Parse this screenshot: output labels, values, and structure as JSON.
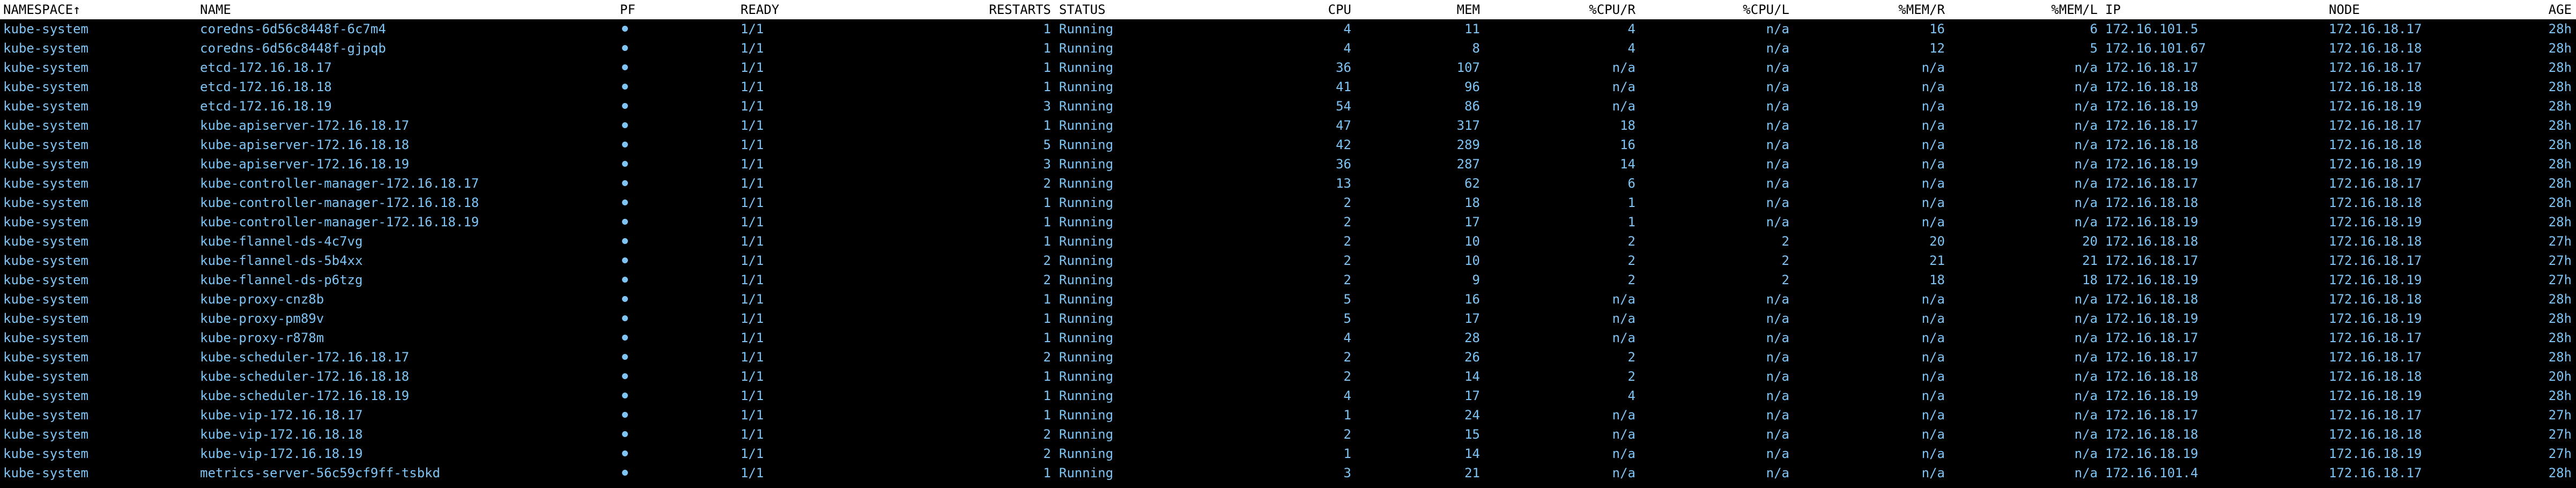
{
  "theme": {
    "foreground": "#7ec4f5",
    "header_bg": "#ffffff",
    "background": "#000000"
  },
  "header": {
    "namespace": "NAMESPACE↑",
    "name": "NAME",
    "pf": "PF",
    "ready": "READY",
    "restarts": "RESTARTS",
    "status": "STATUS",
    "cpu": "CPU",
    "mem": "MEM",
    "cpu_r": "%CPU/R",
    "cpu_l": "%CPU/L",
    "mem_r": "%MEM/R",
    "mem_l": "%MEM/L",
    "ip": "IP",
    "node": "NODE",
    "age": "AGE"
  },
  "pf_icon": "port-forward-dot-icon",
  "rows": [
    {
      "namespace": "kube-system",
      "name": "coredns-6d56c8448f-6c7m4",
      "ready": "1/1",
      "restarts": "1",
      "status": "Running",
      "cpu": "4",
      "mem": "11",
      "cpu_r": "4",
      "cpu_l": "n/a",
      "mem_r": "16",
      "mem_l": "6",
      "ip": "172.16.101.5",
      "node": "172.16.18.17",
      "age": "28h"
    },
    {
      "namespace": "kube-system",
      "name": "coredns-6d56c8448f-gjpqb",
      "ready": "1/1",
      "restarts": "1",
      "status": "Running",
      "cpu": "4",
      "mem": "8",
      "cpu_r": "4",
      "cpu_l": "n/a",
      "mem_r": "12",
      "mem_l": "5",
      "ip": "172.16.101.67",
      "node": "172.16.18.18",
      "age": "28h"
    },
    {
      "namespace": "kube-system",
      "name": "etcd-172.16.18.17",
      "ready": "1/1",
      "restarts": "1",
      "status": "Running",
      "cpu": "36",
      "mem": "107",
      "cpu_r": "n/a",
      "cpu_l": "n/a",
      "mem_r": "n/a",
      "mem_l": "n/a",
      "ip": "172.16.18.17",
      "node": "172.16.18.17",
      "age": "28h"
    },
    {
      "namespace": "kube-system",
      "name": "etcd-172.16.18.18",
      "ready": "1/1",
      "restarts": "1",
      "status": "Running",
      "cpu": "41",
      "mem": "96",
      "cpu_r": "n/a",
      "cpu_l": "n/a",
      "mem_r": "n/a",
      "mem_l": "n/a",
      "ip": "172.16.18.18",
      "node": "172.16.18.18",
      "age": "28h"
    },
    {
      "namespace": "kube-system",
      "name": "etcd-172.16.18.19",
      "ready": "1/1",
      "restarts": "3",
      "status": "Running",
      "cpu": "54",
      "mem": "86",
      "cpu_r": "n/a",
      "cpu_l": "n/a",
      "mem_r": "n/a",
      "mem_l": "n/a",
      "ip": "172.16.18.19",
      "node": "172.16.18.19",
      "age": "28h"
    },
    {
      "namespace": "kube-system",
      "name": "kube-apiserver-172.16.18.17",
      "ready": "1/1",
      "restarts": "1",
      "status": "Running",
      "cpu": "47",
      "mem": "317",
      "cpu_r": "18",
      "cpu_l": "n/a",
      "mem_r": "n/a",
      "mem_l": "n/a",
      "ip": "172.16.18.17",
      "node": "172.16.18.17",
      "age": "28h"
    },
    {
      "namespace": "kube-system",
      "name": "kube-apiserver-172.16.18.18",
      "ready": "1/1",
      "restarts": "5",
      "status": "Running",
      "cpu": "42",
      "mem": "289",
      "cpu_r": "16",
      "cpu_l": "n/a",
      "mem_r": "n/a",
      "mem_l": "n/a",
      "ip": "172.16.18.18",
      "node": "172.16.18.18",
      "age": "28h"
    },
    {
      "namespace": "kube-system",
      "name": "kube-apiserver-172.16.18.19",
      "ready": "1/1",
      "restarts": "3",
      "status": "Running",
      "cpu": "36",
      "mem": "287",
      "cpu_r": "14",
      "cpu_l": "n/a",
      "mem_r": "n/a",
      "mem_l": "n/a",
      "ip": "172.16.18.19",
      "node": "172.16.18.19",
      "age": "28h"
    },
    {
      "namespace": "kube-system",
      "name": "kube-controller-manager-172.16.18.17",
      "ready": "1/1",
      "restarts": "2",
      "status": "Running",
      "cpu": "13",
      "mem": "62",
      "cpu_r": "6",
      "cpu_l": "n/a",
      "mem_r": "n/a",
      "mem_l": "n/a",
      "ip": "172.16.18.17",
      "node": "172.16.18.17",
      "age": "28h"
    },
    {
      "namespace": "kube-system",
      "name": "kube-controller-manager-172.16.18.18",
      "ready": "1/1",
      "restarts": "1",
      "status": "Running",
      "cpu": "2",
      "mem": "18",
      "cpu_r": "1",
      "cpu_l": "n/a",
      "mem_r": "n/a",
      "mem_l": "n/a",
      "ip": "172.16.18.18",
      "node": "172.16.18.18",
      "age": "28h"
    },
    {
      "namespace": "kube-system",
      "name": "kube-controller-manager-172.16.18.19",
      "ready": "1/1",
      "restarts": "1",
      "status": "Running",
      "cpu": "2",
      "mem": "17",
      "cpu_r": "1",
      "cpu_l": "n/a",
      "mem_r": "n/a",
      "mem_l": "n/a",
      "ip": "172.16.18.19",
      "node": "172.16.18.19",
      "age": "28h"
    },
    {
      "namespace": "kube-system",
      "name": "kube-flannel-ds-4c7vg",
      "ready": "1/1",
      "restarts": "1",
      "status": "Running",
      "cpu": "2",
      "mem": "10",
      "cpu_r": "2",
      "cpu_l": "2",
      "mem_r": "20",
      "mem_l": "20",
      "ip": "172.16.18.18",
      "node": "172.16.18.18",
      "age": "27h"
    },
    {
      "namespace": "kube-system",
      "name": "kube-flannel-ds-5b4xx",
      "ready": "1/1",
      "restarts": "2",
      "status": "Running",
      "cpu": "2",
      "mem": "10",
      "cpu_r": "2",
      "cpu_l": "2",
      "mem_r": "21",
      "mem_l": "21",
      "ip": "172.16.18.17",
      "node": "172.16.18.17",
      "age": "27h"
    },
    {
      "namespace": "kube-system",
      "name": "kube-flannel-ds-p6tzg",
      "ready": "1/1",
      "restarts": "2",
      "status": "Running",
      "cpu": "2",
      "mem": "9",
      "cpu_r": "2",
      "cpu_l": "2",
      "mem_r": "18",
      "mem_l": "18",
      "ip": "172.16.18.19",
      "node": "172.16.18.19",
      "age": "27h"
    },
    {
      "namespace": "kube-system",
      "name": "kube-proxy-cnz8b",
      "ready": "1/1",
      "restarts": "1",
      "status": "Running",
      "cpu": "5",
      "mem": "16",
      "cpu_r": "n/a",
      "cpu_l": "n/a",
      "mem_r": "n/a",
      "mem_l": "n/a",
      "ip": "172.16.18.18",
      "node": "172.16.18.18",
      "age": "28h"
    },
    {
      "namespace": "kube-system",
      "name": "kube-proxy-pm89v",
      "ready": "1/1",
      "restarts": "1",
      "status": "Running",
      "cpu": "5",
      "mem": "17",
      "cpu_r": "n/a",
      "cpu_l": "n/a",
      "mem_r": "n/a",
      "mem_l": "n/a",
      "ip": "172.16.18.19",
      "node": "172.16.18.19",
      "age": "28h"
    },
    {
      "namespace": "kube-system",
      "name": "kube-proxy-r878m",
      "ready": "1/1",
      "restarts": "1",
      "status": "Running",
      "cpu": "4",
      "mem": "28",
      "cpu_r": "n/a",
      "cpu_l": "n/a",
      "mem_r": "n/a",
      "mem_l": "n/a",
      "ip": "172.16.18.17",
      "node": "172.16.18.17",
      "age": "28h"
    },
    {
      "namespace": "kube-system",
      "name": "kube-scheduler-172.16.18.17",
      "ready": "1/1",
      "restarts": "2",
      "status": "Running",
      "cpu": "2",
      "mem": "26",
      "cpu_r": "2",
      "cpu_l": "n/a",
      "mem_r": "n/a",
      "mem_l": "n/a",
      "ip": "172.16.18.17",
      "node": "172.16.18.17",
      "age": "28h"
    },
    {
      "namespace": "kube-system",
      "name": "kube-scheduler-172.16.18.18",
      "ready": "1/1",
      "restarts": "1",
      "status": "Running",
      "cpu": "2",
      "mem": "14",
      "cpu_r": "2",
      "cpu_l": "n/a",
      "mem_r": "n/a",
      "mem_l": "n/a",
      "ip": "172.16.18.18",
      "node": "172.16.18.18",
      "age": "20h"
    },
    {
      "namespace": "kube-system",
      "name": "kube-scheduler-172.16.18.19",
      "ready": "1/1",
      "restarts": "1",
      "status": "Running",
      "cpu": "4",
      "mem": "17",
      "cpu_r": "4",
      "cpu_l": "n/a",
      "mem_r": "n/a",
      "mem_l": "n/a",
      "ip": "172.16.18.19",
      "node": "172.16.18.19",
      "age": "28h"
    },
    {
      "namespace": "kube-system",
      "name": "kube-vip-172.16.18.17",
      "ready": "1/1",
      "restarts": "1",
      "status": "Running",
      "cpu": "1",
      "mem": "24",
      "cpu_r": "n/a",
      "cpu_l": "n/a",
      "mem_r": "n/a",
      "mem_l": "n/a",
      "ip": "172.16.18.17",
      "node": "172.16.18.17",
      "age": "27h"
    },
    {
      "namespace": "kube-system",
      "name": "kube-vip-172.16.18.18",
      "ready": "1/1",
      "restarts": "2",
      "status": "Running",
      "cpu": "2",
      "mem": "15",
      "cpu_r": "n/a",
      "cpu_l": "n/a",
      "mem_r": "n/a",
      "mem_l": "n/a",
      "ip": "172.16.18.18",
      "node": "172.16.18.18",
      "age": "27h"
    },
    {
      "namespace": "kube-system",
      "name": "kube-vip-172.16.18.19",
      "ready": "1/1",
      "restarts": "2",
      "status": "Running",
      "cpu": "1",
      "mem": "14",
      "cpu_r": "n/a",
      "cpu_l": "n/a",
      "mem_r": "n/a",
      "mem_l": "n/a",
      "ip": "172.16.18.19",
      "node": "172.16.18.19",
      "age": "27h"
    },
    {
      "namespace": "kube-system",
      "name": "metrics-server-56c59cf9ff-tsbkd",
      "ready": "1/1",
      "restarts": "1",
      "status": "Running",
      "cpu": "3",
      "mem": "21",
      "cpu_r": "n/a",
      "cpu_l": "n/a",
      "mem_r": "n/a",
      "mem_l": "n/a",
      "ip": "172.16.101.4",
      "node": "172.16.18.17",
      "age": "28h"
    }
  ]
}
